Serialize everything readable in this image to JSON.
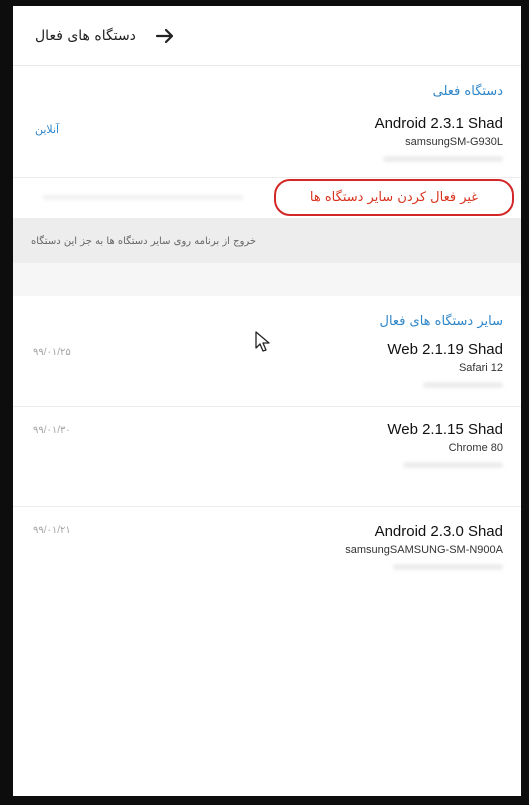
{
  "header": {
    "title": "دستگاه های فعال",
    "back_icon": "arrow-right-icon"
  },
  "current_device": {
    "section_label": "دستگاه فعلی",
    "name": "Android 2.3.1 Shad",
    "model": "samsungSM-G930L",
    "status": "آنلاین"
  },
  "terminate": {
    "label": "غیر فعال کردن سایر دستگاه ها",
    "hint": "خروج از برنامه روی سایر دستگاه ها به جز این دستگاه"
  },
  "other_devices": {
    "section_label": "سایر دستگاه های فعال",
    "sessions": [
      {
        "name": "Web 2.1.19 Shad",
        "detail": "Safari 12",
        "date": "۹۹/۰۱/۲۵"
      },
      {
        "name": "Web 2.1.15 Shad",
        "detail": "Chrome 80",
        "date": "۹۹/۰۱/۳۰"
      },
      {
        "name": "Android 2.3.0 Shad",
        "detail": "samsungSAMSUNG-SM-N900A",
        "date": "۹۹/۰۱/۲۱"
      }
    ]
  },
  "colors": {
    "accent": "#2f86c8",
    "danger": "#d9341f",
    "highlight_ring": "#d32626"
  }
}
